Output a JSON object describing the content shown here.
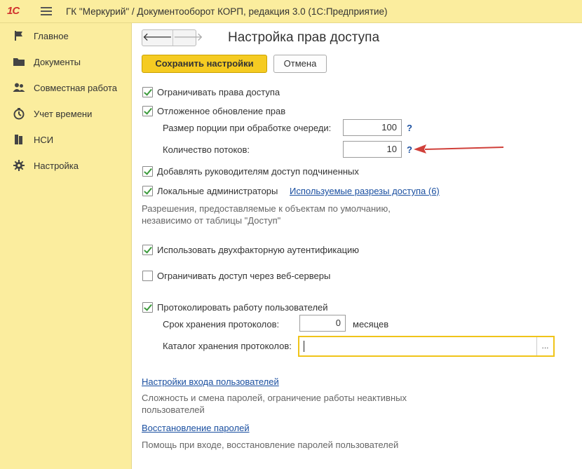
{
  "app": {
    "logo_text": "1С",
    "title": "ГК \"Меркурий\" / Документооборот КОРП, редакция 3.0  (1С:Предприятие)"
  },
  "sidebar": {
    "items": [
      {
        "label": "Главное",
        "icon": "flag-icon"
      },
      {
        "label": "Документы",
        "icon": "folder-icon"
      },
      {
        "label": "Совместная работа",
        "icon": "people-icon"
      },
      {
        "label": "Учет времени",
        "icon": "timer-icon"
      },
      {
        "label": "НСИ",
        "icon": "books-icon"
      },
      {
        "label": "Настройка",
        "icon": "gear-icon"
      }
    ]
  },
  "header": {
    "back_glyph": "🡐",
    "forward_glyph": "🡒",
    "page_title": "Настройка прав доступа"
  },
  "toolbar": {
    "save_label": "Сохранить настройки",
    "cancel_label": "Отмена"
  },
  "settings": {
    "restrict_access": {
      "label": "Ограничивать права доступа",
      "checked": true
    },
    "deferred_update": {
      "label": "Отложенное обновление прав",
      "checked": true
    },
    "batch_size": {
      "label": "Размер порции при обработке очереди:",
      "value": "100",
      "help": "?"
    },
    "threads": {
      "label": "Количество потоков:",
      "value": "10",
      "help": "?"
    },
    "managers_access": {
      "label": "Добавлять руководителям доступ подчиненных",
      "checked": true
    },
    "local_admins": {
      "label": "Локальные администраторы",
      "checked": true,
      "link": "Используемые разрезы доступа (6)"
    },
    "local_admins_hint": "Разрешения, предоставляемые к объектам по умолчанию, независимо от таблицы \"Доступ\"",
    "two_factor": {
      "label": "Использовать двухфакторную аутентификацию",
      "checked": true
    },
    "web_servers": {
      "label": "Ограничивать доступ через веб-серверы",
      "checked": false
    },
    "logging": {
      "label": "Протоколировать работу пользователей",
      "checked": true
    },
    "retention": {
      "label": "Срок хранения протоколов:",
      "value": "0",
      "unit": "месяцев"
    },
    "log_dir": {
      "label": "Каталог хранения протоколов:",
      "value": "",
      "select_glyph": "..."
    }
  },
  "links": {
    "login_settings": "Настройки входа пользователей",
    "login_settings_hint": "Сложность и смена паролей, ограничение работы неактивных пользователей",
    "password_recovery": "Восстановление паролей",
    "password_recovery_hint": "Помощь при входе, восстановление паролей пользователей"
  },
  "colors": {
    "sidebar_bg": "#fbed9e",
    "accent_button": "#f5cb22",
    "checkbox_green": "#3c9a3c",
    "link_blue": "#1a4fa0",
    "annotation_arrow": "#d0403a"
  }
}
